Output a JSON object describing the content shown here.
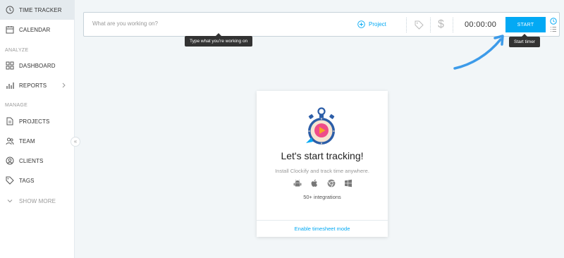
{
  "sidebar": {
    "items": [
      {
        "label": "TIME TRACKER",
        "icon": "clock-icon"
      },
      {
        "label": "CALENDAR",
        "icon": "calendar-icon"
      },
      {
        "label": "DASHBOARD",
        "icon": "dashboard-icon"
      },
      {
        "label": "REPORTS",
        "icon": "bar-chart-icon"
      },
      {
        "label": "PROJECTS",
        "icon": "file-icon"
      },
      {
        "label": "TEAM",
        "icon": "team-icon"
      },
      {
        "label": "CLIENTS",
        "icon": "clients-icon"
      },
      {
        "label": "TAGS",
        "icon": "tag-icon"
      },
      {
        "label": "SHOW MORE",
        "icon": "chevron-down-icon"
      }
    ],
    "sections": {
      "analyze": "ANALYZE",
      "manage": "MANAGE"
    },
    "collapse_glyph": "«"
  },
  "tracker": {
    "description_placeholder": "What are you working on?",
    "project_label": "Project",
    "billable_glyph": "$",
    "timer": "00:00:00",
    "start_label": "START"
  },
  "tooltips": {
    "description": "Type what you're working on",
    "start": "Start timer"
  },
  "empty_state": {
    "title": "Let's start tracking!",
    "subtitle": "Install Clockify and track time anywhere.",
    "platforms": [
      "android-icon",
      "apple-icon",
      "chrome-icon",
      "windows-icon"
    ],
    "integrations": "50+ integrations",
    "footer_link": "Enable timesheet mode"
  },
  "colors": {
    "accent": "#03a9f4",
    "sidebar_active": "#e4eaee",
    "page_bg": "#f2f6f8",
    "tooltip_bg": "#333333"
  }
}
